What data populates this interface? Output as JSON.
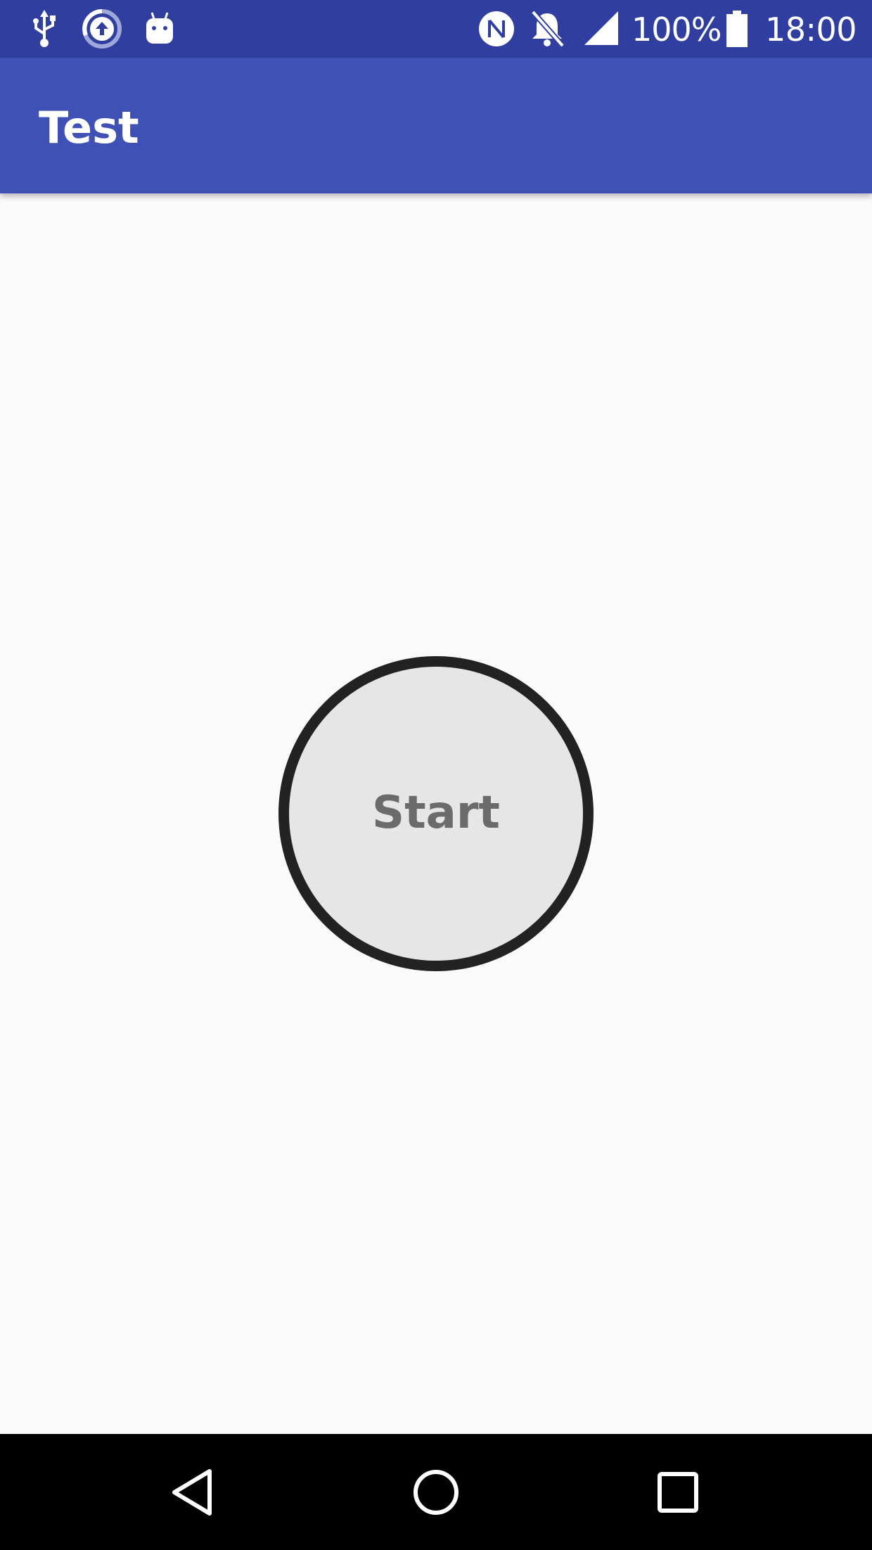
{
  "status_bar": {
    "left_icons": [
      "usb-icon",
      "upload-sync-icon",
      "android-debug-icon"
    ],
    "right_icons": [
      "nfc-icon",
      "notifications-off-icon",
      "cell-signal-icon",
      "battery-icon"
    ],
    "battery_percent": "100%",
    "time": "18:00"
  },
  "app_bar": {
    "title": "Test"
  },
  "main": {
    "start_button_label": "Start"
  },
  "nav_bar": {
    "buttons": [
      "back-icon",
      "home-icon",
      "recents-icon"
    ]
  },
  "colors": {
    "status_bar": "#303f9f",
    "app_bar": "#3f51b5",
    "background": "#fafafa",
    "button_fill": "#e6e6e6",
    "button_border": "#222222",
    "button_text": "#6b6b6b",
    "nav_bar": "#000000"
  }
}
